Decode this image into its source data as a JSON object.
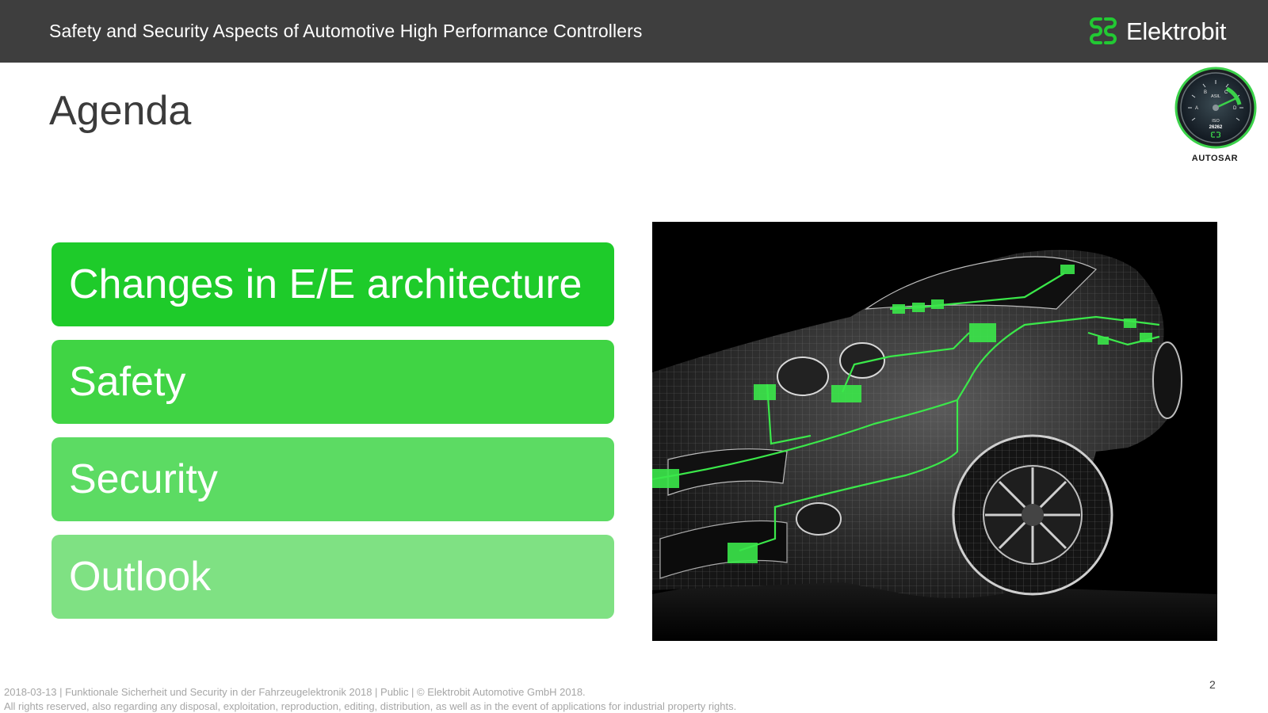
{
  "header": {
    "title": "Safety and Security Aspects of Automotive High Performance Controllers",
    "brand_name": "Elektrobit",
    "brand_icon": "elektrobit-logo-icon"
  },
  "page": {
    "title": "Agenda",
    "number": "2"
  },
  "badge": {
    "icon": "asil-gauge-icon",
    "gauge_labels": [
      "A",
      "B",
      "C",
      "D",
      "ASIL",
      "ISO",
      "26262"
    ],
    "autosar_text": "AUTOSAR"
  },
  "agenda": {
    "items": [
      {
        "label": "Changes in E/E architecture",
        "color": "#1ecb2a"
      },
      {
        "label": "Safety",
        "color": "#40d444"
      },
      {
        "label": "Security",
        "color": "#5cdb63"
      },
      {
        "label": "Outlook",
        "color": "#7fe183"
      }
    ]
  },
  "image": {
    "subject": "wireframe-car-with-green-ecu-network"
  },
  "footer": {
    "line1": "2018-03-13 | Funktionale Sicherheit und Security in der Fahrzeugelektronik 2018 | Public | © Elektrobit Automotive GmbH 2018.",
    "line2": "All rights reserved, also regarding any disposal,  exploitation, reproduction, editing, distribution, as well as in the event of applications for industrial property rights."
  },
  "colors": {
    "header_bg": "#3e3e3e",
    "accent_green": "#22c933",
    "title_text": "#3b3b3b",
    "footer_text": "#a6a6a6"
  }
}
